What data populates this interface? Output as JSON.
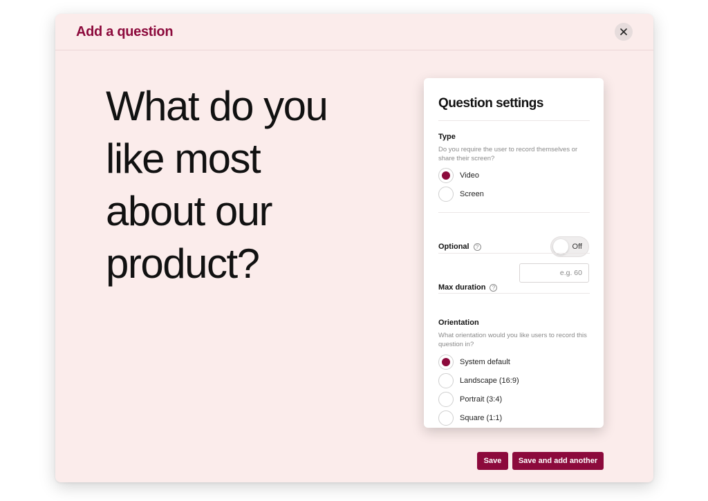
{
  "modal": {
    "title": "Add a question",
    "question_text": "What do you like most about our product?"
  },
  "settings": {
    "title": "Question settings",
    "type": {
      "label": "Type",
      "description": "Do you require the user to record themselves or share their screen?",
      "options": [
        {
          "label": "Video",
          "selected": true
        },
        {
          "label": "Screen",
          "selected": false
        }
      ]
    },
    "optional": {
      "label": "Optional",
      "toggle_text": "Off",
      "value": false
    },
    "max_duration": {
      "label": "Max duration",
      "placeholder": "e.g. 60",
      "value": ""
    },
    "orientation": {
      "label": "Orientation",
      "description": "What orientation would you like users  to record this question in?",
      "options": [
        {
          "label": "System default",
          "selected": true
        },
        {
          "label": "Landscape (16:9)",
          "selected": false
        },
        {
          "label": "Portrait (3:4)",
          "selected": false
        },
        {
          "label": "Square (1:1)",
          "selected": false
        }
      ]
    }
  },
  "footer": {
    "save_label": "Save",
    "save_and_add_label": "Save and add another"
  },
  "colors": {
    "accent": "#8c0a3c",
    "modal_background": "#fbeceb"
  },
  "icons": {
    "close": "close-icon",
    "help": "help-circle-icon"
  }
}
